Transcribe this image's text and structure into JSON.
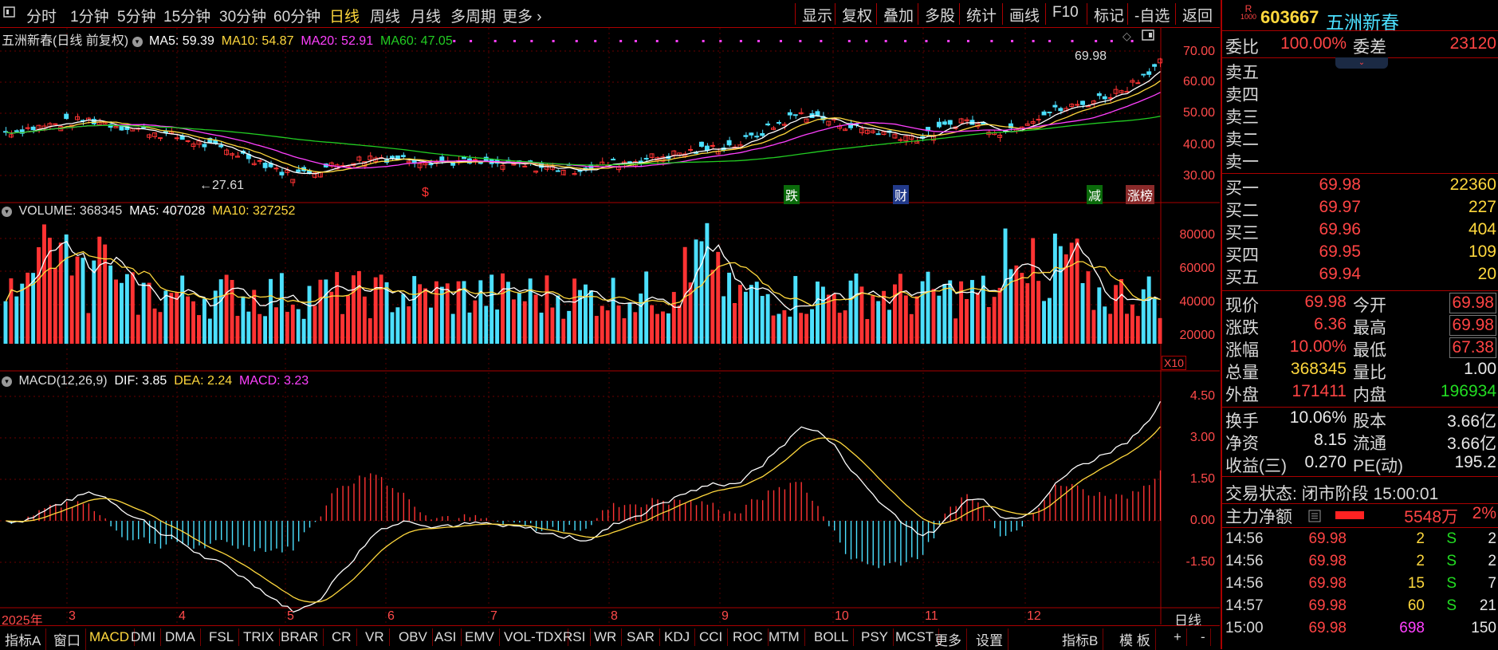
{
  "toolbar": {
    "tabs": [
      "分时",
      "1分钟",
      "5分钟",
      "15分钟",
      "30分钟",
      "60分钟",
      "日线",
      "周线",
      "月线",
      "多周期",
      "更多"
    ],
    "active_tab": "日线",
    "right_buttons": [
      "显示",
      "复权",
      "叠加",
      "多股",
      "统计",
      "画线",
      "F10",
      "标记",
      "-自选",
      "返回"
    ]
  },
  "kline": {
    "title": "五洲新春(日线 前复权)",
    "ma5": "MA5: 59.39",
    "ma10": "MA10: 54.87",
    "ma20": "MA20: 52.91",
    "ma60": "MA60: 47.05",
    "y_ticks": [
      "70.00",
      "60.00",
      "50.00",
      "40.00",
      "30.00"
    ],
    "high_label": "69.98",
    "low_label": "←27.61",
    "markers": [
      "$",
      "跌",
      "财",
      "减",
      "涨榜"
    ]
  },
  "volume": {
    "title": "VOLUME: 368345",
    "ma5": "MA5: 407028",
    "ma10": "MA10: 327252",
    "y_ticks": [
      "80000",
      "60000",
      "40000",
      "20000"
    ],
    "unit": "X10"
  },
  "macd": {
    "title": "MACD(12,26,9)",
    "dif": "DIF: 3.85",
    "dea": "DEA: 2.24",
    "macd": "MACD: 3.23",
    "y_ticks": [
      "4.50",
      "3.00",
      "1.50",
      "0.00",
      "-1.50"
    ]
  },
  "x_axis": [
    "2025年",
    "3",
    "4",
    "5",
    "6",
    "7",
    "8",
    "9",
    "10",
    "11",
    "12"
  ],
  "x_axis_right": "日线",
  "bottom_tabs": [
    "指标A",
    "窗口",
    "MACD",
    "DMI",
    "DMA",
    "FSL",
    "TRIX",
    "BRAR",
    "CR",
    "VR",
    "OBV",
    "ASI",
    "EMV",
    "VOL-TDX",
    "RSI",
    "WR",
    "SAR",
    "KDJ",
    "CCI",
    "ROC",
    "MTM",
    "BOLL",
    "PSY",
    "MCST",
    "更多",
    "设置"
  ],
  "bottom_active": "MACD",
  "bottom_right": [
    "指标B",
    "模 板",
    "+",
    "-"
  ],
  "quote": {
    "badge_top": "R",
    "badge_bottom": "1000",
    "code": "603667",
    "name": "五洲新春",
    "weibi_label": "委比",
    "weibi": "100.00%",
    "weicha_label": "委差",
    "weicha": "23120",
    "asks": [
      {
        "label": "卖五"
      },
      {
        "label": "卖四"
      },
      {
        "label": "卖三"
      },
      {
        "label": "卖二"
      },
      {
        "label": "卖一"
      }
    ],
    "bids": [
      {
        "label": "买一",
        "price": "69.98",
        "vol": "22360"
      },
      {
        "label": "买二",
        "price": "69.97",
        "vol": "227"
      },
      {
        "label": "买三",
        "price": "69.96",
        "vol": "404"
      },
      {
        "label": "买四",
        "price": "69.95",
        "vol": "109"
      },
      {
        "label": "买五",
        "price": "69.94",
        "vol": "20"
      }
    ],
    "stats": [
      {
        "l1": "现价",
        "v1": "69.98",
        "l2": "今开",
        "v2": "69.98"
      },
      {
        "l1": "涨跌",
        "v1": "6.36",
        "l2": "最高",
        "v2": "69.98"
      },
      {
        "l1": "涨幅",
        "v1": "10.00%",
        "l2": "最低",
        "v2": "67.38"
      },
      {
        "l1": "总量",
        "v1": "368345",
        "l2": "量比",
        "v2": "1.00"
      },
      {
        "l1": "外盘",
        "v1": "171411",
        "l2": "内盘",
        "v2": "196934"
      }
    ],
    "fund": [
      {
        "l1": "换手",
        "v1": "10.06%",
        "l2": "股本",
        "v2": "3.66亿"
      },
      {
        "l1": "净资",
        "v1": "8.15",
        "l2": "流通",
        "v2": "3.66亿"
      },
      {
        "l1": "收益(三)",
        "v1": "0.270",
        "l2": "PE(动)",
        "v2": "195.2"
      }
    ],
    "trade_status": "交易状态: 闭市阶段 15:00:01",
    "main_net_label": "主力净额",
    "main_net": "5548万",
    "main_pct": "2%",
    "ticks": [
      {
        "time": "14:56",
        "price": "69.98",
        "vol": "2",
        "side": "S",
        "n": "2"
      },
      {
        "time": "14:56",
        "price": "69.98",
        "vol": "2",
        "side": "S",
        "n": "2"
      },
      {
        "time": "14:56",
        "price": "69.98",
        "vol": "15",
        "side": "S",
        "n": "7"
      },
      {
        "time": "14:57",
        "price": "69.98",
        "vol": "60",
        "side": "S",
        "n": "21"
      },
      {
        "time": "15:00",
        "price": "69.98",
        "vol": "698",
        "side": "",
        "n": "150"
      }
    ]
  },
  "colors": {
    "up": "#ff3333",
    "down": "#4ce0ff",
    "ma5": "#ffffff",
    "ma10": "#ffd83d",
    "ma20": "#ff40ff",
    "ma60": "#22cc22",
    "border": "#aa0000"
  }
}
